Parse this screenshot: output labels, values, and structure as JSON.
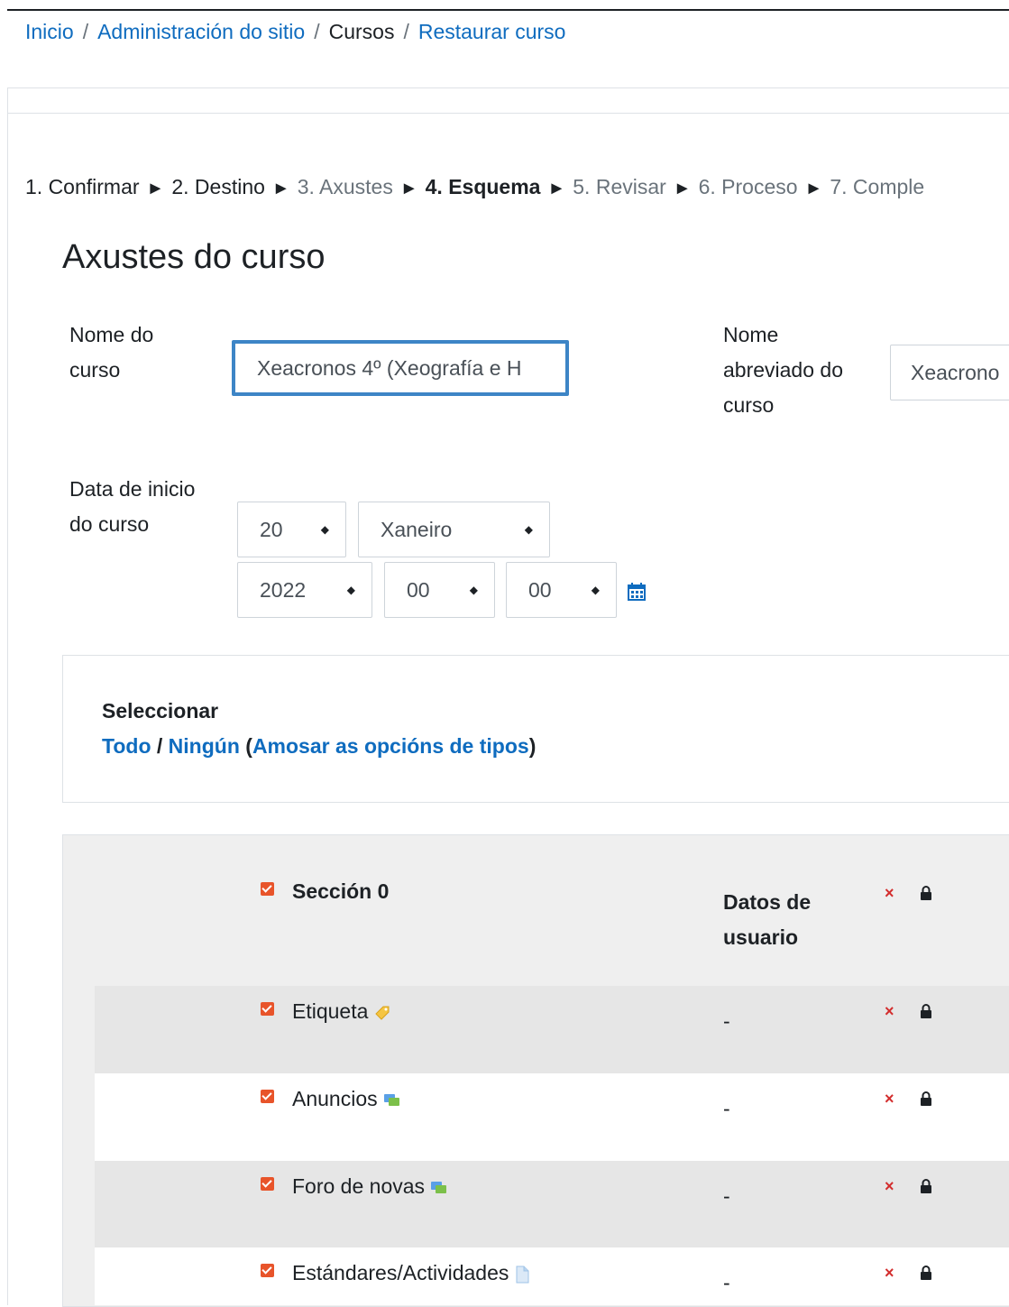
{
  "breadcrumb": {
    "home": "Inicio",
    "admin": "Administración do sitio",
    "courses": "Cursos",
    "restore": "Restaurar curso",
    "separator": "/"
  },
  "stepper": {
    "step1": "1. Confirmar",
    "step2": "2. Destino",
    "step3": "3. Axustes",
    "step4": "4. Esquema",
    "step5": "5. Revisar",
    "step6": "6. Proceso",
    "step7": "7. Comple",
    "arrow": "►"
  },
  "settings": {
    "heading": "Axustes do curso",
    "course_name_label_1": "Nome do",
    "course_name_label_2": "curso",
    "course_name_value": "Xeacronos 4º (Xeografía e H",
    "short_name_label_1": "Nome",
    "short_name_label_2": "abreviado do",
    "short_name_label_3": "curso",
    "short_name_value": "Xeacrono",
    "start_date_label_1": "Data de inicio",
    "start_date_label_2": "do curso",
    "day": "20",
    "month": "Xaneiro",
    "year": "2022",
    "hour": "00",
    "minute": "00"
  },
  "selection": {
    "title": "Seleccionar",
    "all": "Todo",
    "slash": " / ",
    "none": "Ningún",
    "open_paren": " (",
    "show_types": "Amosar as opcións de tipos",
    "close_paren": ")"
  },
  "schema": {
    "user_data_header_1": "Datos de",
    "user_data_header_2": "usuario",
    "section_label": "Sección 0",
    "items": [
      {
        "label": "Etiqueta",
        "user_data": "-",
        "icon": "label-icon"
      },
      {
        "label": "Anuncios",
        "user_data": "-",
        "icon": "forum-icon"
      },
      {
        "label": "Foro de novas",
        "user_data": "-",
        "icon": "forum-icon"
      },
      {
        "label": "Estándares/Actividades",
        "user_data": "-",
        "icon": "file-icon"
      }
    ],
    "exclude_mark": "×",
    "colors": {
      "checkbox": "#e8542a",
      "exclude": "#d32d2d",
      "link": "#0f6cbf"
    }
  }
}
